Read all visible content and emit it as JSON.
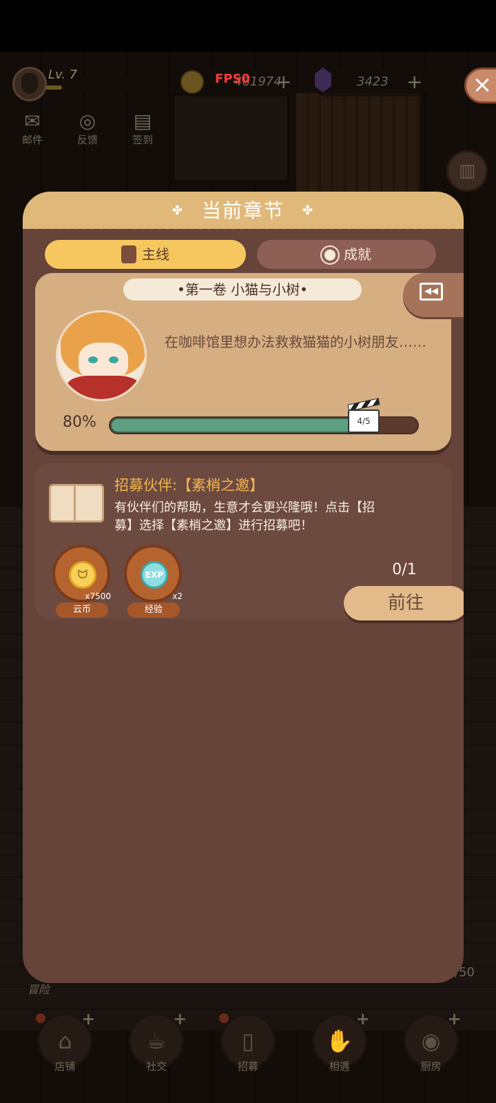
{
  "hud": {
    "level": "Lv. 7",
    "coins": "461974",
    "fps": "FPS0",
    "gems": "3423",
    "plus": "+"
  },
  "side_icons": [
    {
      "label": "邮件",
      "icon": "mail-icon"
    },
    {
      "label": "反馈",
      "icon": "globe-icon"
    },
    {
      "label": "签到",
      "icon": "calendar-icon"
    }
  ],
  "close_label": "×",
  "panel": {
    "title": "当前章节",
    "tabs": [
      {
        "label": "主线",
        "icon": "notebook-icon",
        "active": true
      },
      {
        "label": "成就",
        "icon": "medal-icon",
        "active": false
      }
    ],
    "chapter": {
      "name": "•第一卷 小猫与小树•",
      "description": "在咖啡馆里想办法救救猫猫的小树朋友……",
      "progress_percent_text": "80%",
      "progress_fraction": 0.8,
      "progress_count": "4/5"
    },
    "task": {
      "title": "招募伙伴:【素梢之邀】",
      "description": "有伙伴们的帮助，生意才会更兴隆哦！点击【招募】选择【素梢之邀】进行招募吧！",
      "count": "0/1",
      "go_label": "前往",
      "rewards": [
        {
          "name": "云币",
          "qty": "x7500",
          "icon": "cloud-coin-icon"
        },
        {
          "name": "经验",
          "qty": "x2",
          "icon": "exp-icon"
        }
      ]
    }
  },
  "background": {
    "adventure_label": "冒险",
    "count_text": "/50"
  },
  "bottom_nav": [
    {
      "label": "店铺",
      "icon": "shop-icon"
    },
    {
      "label": "社交",
      "icon": "coffee-icon"
    },
    {
      "label": "招募",
      "icon": "door-icon"
    },
    {
      "label": "相遇",
      "icon": "handshake-icon"
    },
    {
      "label": "厨房",
      "icon": "pan-icon"
    }
  ],
  "colors": {
    "panel": "#66443a",
    "header": "#e0b97a",
    "active_tab": "#f6c75e",
    "progress": "#5fa085",
    "task_title": "#f3b54a"
  }
}
